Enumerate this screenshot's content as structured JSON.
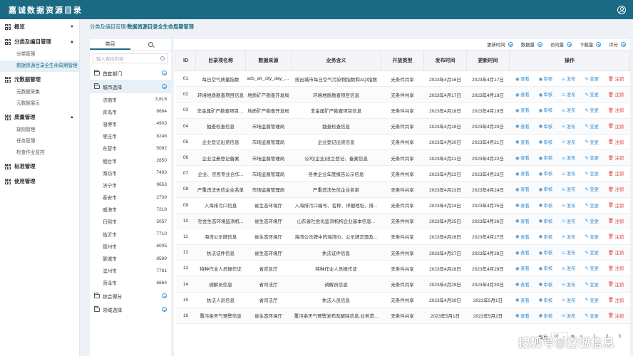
{
  "app": {
    "title": "嘉诚数据资源目录"
  },
  "breadcrumb": {
    "parent": "分类及编目管理",
    "separator": "/",
    "current": "数据资源目录全生命周期管理"
  },
  "sidebar": {
    "groups": [
      {
        "label": "概览",
        "caret": "▼",
        "items": []
      },
      {
        "label": "分类及编目管理",
        "caret": "▲",
        "items": [
          "分类管理",
          "数据资源目录全生命周期管理"
        ]
      },
      {
        "label": "元数据管理",
        "caret": "",
        "items": [
          "元数据采集",
          "元数据展示"
        ]
      },
      {
        "label": "质量管理",
        "caret": "▲",
        "items": [
          "规则管理",
          "任务管理",
          "检查作业监控"
        ]
      },
      {
        "label": "标准管理",
        "caret": "",
        "items": []
      },
      {
        "label": "使用管理",
        "caret": "",
        "items": []
      }
    ]
  },
  "tree": {
    "tab_catalog": "类目",
    "search_placeholder": "输入查找内容",
    "group_department": "首套部门",
    "group_city": "城市选择",
    "cities": [
      {
        "name": "济南市",
        "count": "3,818"
      },
      {
        "name": "青岛市",
        "count": "6684"
      },
      {
        "name": "淄博市",
        "count": "4903"
      },
      {
        "name": "枣庄市",
        "count": "8248"
      },
      {
        "name": "东营市",
        "count": "5092"
      },
      {
        "name": "烟台市",
        "count": "2850"
      },
      {
        "name": "潍坊市",
        "count": "7493"
      },
      {
        "name": "济宁市",
        "count": "9653"
      },
      {
        "name": "泰安市",
        "count": "2739"
      },
      {
        "name": "威海市",
        "count": "7218"
      },
      {
        "name": "日照市",
        "count": "5057"
      },
      {
        "name": "临沂市",
        "count": "7710"
      },
      {
        "name": "德州市",
        "count": "6005"
      },
      {
        "name": "聊城市",
        "count": "8589"
      },
      {
        "name": "滨州市",
        "count": "7781"
      },
      {
        "name": "菏泽市",
        "count": "6864"
      }
    ],
    "group_score": "综合得分",
    "group_domain": "领域选择"
  },
  "filters": [
    "更新时间",
    "数据量",
    "访问量",
    "下载量",
    "评分"
  ],
  "table": {
    "headers": [
      "ID",
      "目录项名称",
      "数据来源",
      "业务含义",
      "开放类型",
      "发布时间",
      "更新时间",
      "操作"
    ],
    "op_labels": {
      "view": "查看",
      "audit": "审核",
      "publish": "发布",
      "change": "变更",
      "cancel": "注销"
    },
    "rows": [
      {
        "id": "01",
        "name": "每日空气质量指数",
        "source": "ads_air_city_day_data",
        "meaning": "统出城市每日空气污染物指数和AQI指数",
        "open": "无条件共享",
        "pub": "2023年4月16日",
        "upd": "2023年4月17日"
      },
      {
        "id": "02",
        "name": "环境地质勘查项目信息",
        "source": "地质矿产勘查开发局",
        "meaning": "环境地质勘查项目信息",
        "open": "无条件共享",
        "pub": "2023年4月17日",
        "upd": "2023年4月18日"
      },
      {
        "id": "03",
        "name": "非金属矿产勘查项目信息",
        "source": "地质矿产勘查开发局",
        "meaning": "非金属矿产勘查项目信息",
        "open": "无条件共享",
        "pub": "2023年4月18日",
        "upd": "2023年4月19日"
      },
      {
        "id": "04",
        "name": "抽查检查信息",
        "source": "市场监督管理局",
        "meaning": "抽查检查信息",
        "open": "无条件共享",
        "pub": "2023年4月19日",
        "upd": "2023年4月20日"
      },
      {
        "id": "05",
        "name": "企业登记出资信息",
        "source": "市场监督管理局",
        "meaning": "企业登记出资信息",
        "open": "无条件共享",
        "pub": "2023年4月20日",
        "upd": "2023年4月21日"
      },
      {
        "id": "06",
        "name": "企业注册登记备案",
        "source": "市场监督管理局",
        "meaning": "公司(企业)设立登记、备案信息",
        "open": "无条件共享",
        "pub": "2023年4月21日",
        "upd": "2023年4月22日"
      },
      {
        "id": "07",
        "name": "企业、农民专业合作...",
        "source": "市场监督管理局",
        "meaning": "各类企业年度报告公示信息",
        "open": "无条件共享",
        "pub": "2023年4月22日",
        "upd": "2023年4月23日"
      },
      {
        "id": "08",
        "name": "严重违法失信企业名单",
        "source": "市场监督管理局",
        "meaning": "严重违法失信企业名单",
        "open": "无条件共享",
        "pub": "2023年4月23日",
        "upd": "2023年4月24日"
      },
      {
        "id": "09",
        "name": "入海排污口信息",
        "source": "省生态环境厅",
        "meaning": "入海排污口编号、名称、详细地址、排...",
        "open": "无条件共享",
        "pub": "2023年4月24日",
        "upd": "2023年4月25日"
      },
      {
        "id": "10",
        "name": "社会生态环境监测机...",
        "source": "省生态环境厅",
        "meaning": "山东省社会化监测机构企业基本信息...",
        "open": "无条件共享",
        "pub": "2023年4月25日",
        "upd": "2023年4月26日"
      },
      {
        "id": "11",
        "name": "海湾公示牌信息",
        "source": "省生态环境厅",
        "meaning": "海湾公示牌中的海湾ID、公示牌正面及...",
        "open": "无条件共享",
        "pub": "2023年4月26日",
        "upd": "2023年4月27日"
      },
      {
        "id": "12",
        "name": "执法证件信息",
        "source": "省生态环境厅",
        "meaning": "执法证件信息",
        "open": "无条件共享",
        "pub": "2023年4月27日",
        "upd": "2023年4月28日"
      },
      {
        "id": "13",
        "name": "特种作业人员操作证",
        "source": "省应急厅",
        "meaning": "特种作业人员操作证",
        "open": "无条件共享",
        "pub": "2023年4月28日",
        "upd": "2023年4月29日"
      },
      {
        "id": "14",
        "name": "调解员信息",
        "source": "省司法厅",
        "meaning": "调解员信息",
        "open": "无条件共享",
        "pub": "2023年4月29日",
        "upd": "2023年4月30日"
      },
      {
        "id": "15",
        "name": "执法人员信息",
        "source": "省司法厅",
        "meaning": "执法人员信息",
        "open": "无条件共享",
        "pub": "2023年4月30日",
        "upd": "2023年5月1日"
      },
      {
        "id": "16",
        "name": "重污染天气预警信息",
        "source": "省生态环境厅",
        "meaning": "重污染天气预警发布及解除信息,业务范...",
        "open": "无条件共享",
        "pub": "2023年5月1日",
        "upd": "2023年5月2日"
      }
    ]
  },
  "pager": {
    "per_page_label": "每页",
    "per_page_value": "10",
    "unit": "条",
    "prev": "<",
    "pages": [
      "1",
      "2",
      "3"
    ]
  },
  "watermark": "搜狐号@嘉诚信息"
}
